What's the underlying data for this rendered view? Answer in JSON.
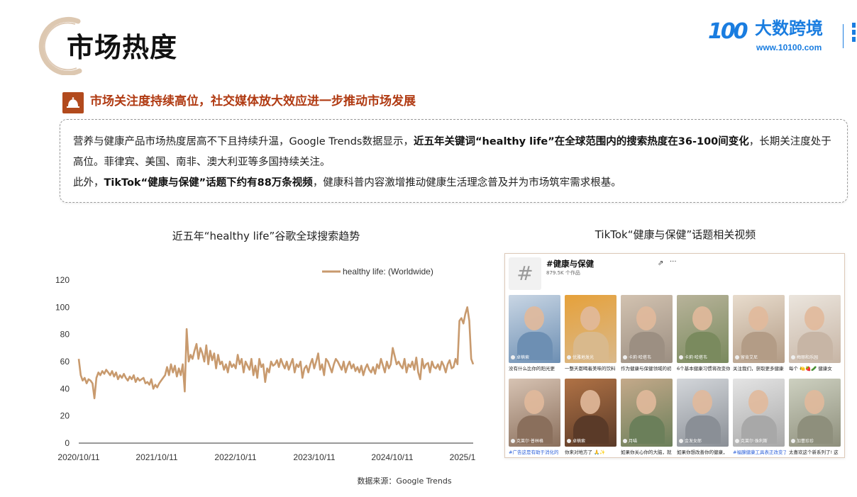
{
  "header": {
    "page_title": "市场热度",
    "brand_name": "大数跨境",
    "brand_url": "www.10100.com",
    "brand_mark": "100",
    "brand_color": "#1a7de0",
    "accent_color": "#b03a12"
  },
  "subheading": "市场关注度持续高位，社交媒体放大效应进一步推动市场发展",
  "description": {
    "p1_a": "营养与健康产品市场热度居高不下且持续升温，Google Trends数据显示，",
    "p1_b": "近五年关键词“healthy life”在全球范围内的搜索热度在36-100间变化",
    "p1_c": "，长期关注度处于高位。菲律宾、美国、南非、澳大利亚等多国持续关注。",
    "p2_a": "此外，",
    "p2_b": "TikTok“健康与保健”话题下约有88万条视频",
    "p2_c": "，健康科普内容激增推动健康生活理念普及并为市场筑牢需求根基。"
  },
  "chart_title": "近五年“healthy life”谷歌全球搜索趋势",
  "source": "数据来源：Google Trends",
  "chart_data": {
    "type": "line",
    "title": "近五年“healthy life”谷歌全球搜索趋势",
    "xlabel": "",
    "ylabel": "",
    "ylim": [
      0,
      120
    ],
    "yticks": [
      0,
      20,
      40,
      60,
      80,
      100,
      120
    ],
    "xtick_labels": [
      "2020/10/11",
      "2021/10/11",
      "2022/10/11",
      "2023/10/11",
      "2024/10/11",
      "2025/1"
    ],
    "legend_position": "top-right",
    "grid": false,
    "series": [
      {
        "name": "healthy life: (Worldwide)",
        "color": "#c89a6e",
        "values": [
          62,
          50,
          46,
          48,
          44,
          47,
          46,
          44,
          33,
          48,
          52,
          50,
          53,
          51,
          54,
          52,
          50,
          53,
          49,
          52,
          47,
          50,
          48,
          51,
          48,
          46,
          49,
          47,
          50,
          45,
          48,
          46,
          47,
          48,
          44,
          45,
          43,
          47,
          40,
          43,
          41,
          44,
          46,
          48,
          50,
          56,
          50,
          58,
          52,
          57,
          49,
          55,
          50,
          58,
          38,
          84,
          60,
          65,
          62,
          68,
          73,
          62,
          70,
          66,
          60,
          72,
          58,
          68,
          61,
          66,
          55,
          65,
          58,
          60,
          54,
          58,
          52,
          60,
          56,
          58,
          55,
          65,
          58,
          62,
          52,
          60,
          57,
          54,
          62,
          50,
          57,
          48,
          62,
          56,
          58,
          45,
          55,
          52,
          60,
          57,
          58,
          61,
          56,
          62,
          58,
          55,
          60,
          54,
          58,
          62,
          52,
          58,
          56,
          60,
          48,
          55,
          57,
          52,
          58,
          62,
          55,
          60,
          66,
          54,
          58,
          50,
          62,
          60,
          56,
          52,
          58,
          62,
          60,
          57,
          54,
          60,
          52,
          57,
          60,
          55,
          58,
          53,
          56,
          52,
          57,
          50,
          55,
          58,
          54,
          52,
          56,
          51,
          58,
          55,
          62,
          57,
          52,
          60,
          55,
          58,
          70,
          64,
          58,
          60,
          57,
          55,
          62,
          52,
          58,
          56,
          60,
          54,
          63,
          52,
          47,
          62,
          55,
          58,
          59,
          52,
          60,
          56,
          55,
          58,
          54,
          60,
          57,
          52,
          58,
          61,
          55,
          56,
          62,
          58,
          90,
          92,
          88,
          95,
          100,
          90,
          62,
          58
        ]
      }
    ]
  },
  "tiktok": {
    "title": "TikTok“健康与保健”话题相关视频",
    "tag": "#健康与保健",
    "count": "879.5K 个作品",
    "share_icon": "share-icon",
    "more_icon": "more-icon",
    "hash_symbol": "#",
    "share_glyph": "⇗",
    "more_glyph": "···",
    "videos": [
      {
        "user": "卓楠索",
        "caption": "没有什么比你的阳光更",
        "colors": [
          "#6d8fb3",
          "#c9d6e4"
        ]
      },
      {
        "user": "优雅地发光",
        "caption": "一整天都喝着美味的饮料",
        "colors": [
          "#d9b98c",
          "#e6a13a"
        ]
      },
      {
        "user": "卡莉·哈塔韦",
        "caption": "作为健康与保健领域的初",
        "colors": [
          "#9c8f82",
          "#d2c2b0"
        ]
      },
      {
        "user": "卡莉·哈塔韦",
        "caption": "6个基本健康习惯将改变你",
        "colors": [
          "#7a8a5e",
          "#b8b39a"
        ]
      },
      {
        "user": "留肯艾尼",
        "caption": "关注我们，获取更多健康",
        "colors": [
          "#b39c86",
          "#e8dccd"
        ]
      },
      {
        "user": "梅丽和乐园",
        "caption": "每个 🍋🍓🥒 健康女",
        "colors": [
          "#c7b5a5",
          "#ebe5dd"
        ]
      },
      {
        "user": "克莱尔·普林格",
        "caption": "#广告这是有助于消化的",
        "colors": [
          "#8a6f5c",
          "#d7c3b3"
        ]
      },
      {
        "user": "卓楠索",
        "caption": "你来对地方了 🙏✨",
        "colors": [
          "#5a3a28",
          "#b07245"
        ]
      },
      {
        "user": "月喵",
        "caption": "如果你关心你的大脑，就",
        "colors": [
          "#6b7f5a",
          "#c4a98a"
        ]
      },
      {
        "user": "金发女郎",
        "caption": "如果你想改善你的健康，",
        "colors": [
          "#8a8f96",
          "#d3d6da"
        ]
      },
      {
        "user": "克莱尔·珠利斯",
        "caption": "#福腺健康工具表正改变了",
        "colors": [
          "#a8a8a8",
          "#e4e4e4"
        ]
      },
      {
        "user": "加蕾珍珍",
        "caption": "太喜欢这个新系列了! 这",
        "colors": [
          "#8e8f7c",
          "#cdd0c0"
        ]
      }
    ]
  }
}
